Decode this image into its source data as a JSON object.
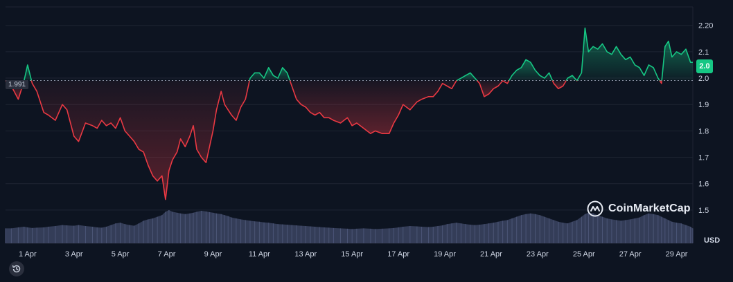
{
  "watermark": {
    "text": "CoinMarketCap"
  },
  "currency": "USD",
  "colors": {
    "up": "#16c784",
    "down": "#ea3943",
    "background": "#0d1421",
    "grid": "#1e2433",
    "volume": "#3c4462"
  },
  "icons": {
    "history": "history-icon",
    "logo": "coinmarketcap-logo-icon"
  },
  "chart_data": {
    "type": "area",
    "reference_value": 1.991,
    "reference_label": "1.991",
    "current_label": "2.0",
    "y_ticks": [
      "2.20",
      "2.1",
      "2.0",
      "1.9",
      "1.8",
      "1.7",
      "1.6",
      "1.5"
    ],
    "y_tick_values": [
      2.2,
      2.1,
      2.0,
      1.9,
      1.8,
      1.7,
      1.6,
      1.5
    ],
    "ylim": [
      1.45,
      2.27
    ],
    "x_ticks": [
      "1 Apr",
      "3 Apr",
      "5 Apr",
      "7 Apr",
      "9 Apr",
      "11 Apr",
      "13 Apr",
      "15 Apr",
      "17 Apr",
      "19 Apr",
      "21 Apr",
      "23 Apr",
      "25 Apr",
      "27 Apr",
      "29 Apr"
    ],
    "x_tick_days": [
      1,
      3,
      5,
      7,
      9,
      11,
      13,
      15,
      17,
      19,
      21,
      23,
      25,
      27,
      29
    ],
    "xlim_days": [
      0.05,
      29.7
    ],
    "series": [
      {
        "x_days": [
          0.05,
          0.3,
          0.6,
          0.85,
          1.0,
          1.2,
          1.4,
          1.7,
          1.9,
          2.2,
          2.5,
          2.7,
          3.0,
          3.2,
          3.5,
          3.8,
          4.0,
          4.2,
          4.4,
          4.6,
          4.8,
          5.0,
          5.2,
          5.4,
          5.6,
          5.8,
          6.0,
          6.2,
          6.4,
          6.6,
          6.8,
          6.95,
          7.1,
          7.25,
          7.45,
          7.6,
          7.8,
          8.0,
          8.15,
          8.3,
          8.5,
          8.7,
          8.85,
          9.0,
          9.15,
          9.35,
          9.5,
          9.65,
          9.8,
          10.0,
          10.2,
          10.4,
          10.6,
          10.8,
          11.0,
          11.2,
          11.4,
          11.6,
          11.8,
          12.0,
          12.2,
          12.4,
          12.6,
          12.8,
          13.0,
          13.2,
          13.4,
          13.6,
          13.8,
          14.0,
          14.2,
          14.5,
          14.8,
          15.0,
          15.2,
          15.5,
          15.8,
          16.0,
          16.3,
          16.6,
          16.8,
          17.0,
          17.2,
          17.5,
          17.8,
          18.0,
          18.3,
          18.5,
          18.7,
          18.9,
          19.1,
          19.3,
          19.5,
          19.7,
          19.9,
          20.1,
          20.3,
          20.5,
          20.7,
          20.9,
          21.1,
          21.3,
          21.5,
          21.7,
          21.9,
          22.1,
          22.3,
          22.5,
          22.7,
          22.9,
          23.1,
          23.3,
          23.5,
          23.7,
          23.9,
          24.1,
          24.3,
          24.5,
          24.7,
          24.9,
          25.05,
          25.2,
          25.4,
          25.6,
          25.8,
          26.0,
          26.2,
          26.4,
          26.6,
          26.8,
          27.0,
          27.2,
          27.4,
          27.6,
          27.8,
          28.0,
          28.2,
          28.35,
          28.5,
          28.65,
          28.8,
          29.0,
          29.2,
          29.4,
          29.6,
          29.7
        ],
        "y": [
          1.99,
          1.97,
          1.92,
          1.99,
          2.05,
          1.98,
          1.95,
          1.87,
          1.86,
          1.84,
          1.9,
          1.88,
          1.78,
          1.76,
          1.83,
          1.82,
          1.81,
          1.84,
          1.82,
          1.83,
          1.81,
          1.85,
          1.8,
          1.78,
          1.76,
          1.73,
          1.72,
          1.67,
          1.63,
          1.61,
          1.63,
          1.54,
          1.65,
          1.69,
          1.72,
          1.77,
          1.74,
          1.78,
          1.82,
          1.73,
          1.7,
          1.68,
          1.74,
          1.8,
          1.88,
          1.95,
          1.9,
          1.88,
          1.86,
          1.84,
          1.89,
          1.92,
          2.0,
          2.02,
          2.02,
          2.0,
          2.04,
          2.01,
          2.0,
          2.04,
          2.02,
          1.97,
          1.92,
          1.9,
          1.89,
          1.87,
          1.86,
          1.87,
          1.85,
          1.85,
          1.84,
          1.83,
          1.85,
          1.82,
          1.83,
          1.81,
          1.79,
          1.8,
          1.79,
          1.79,
          1.83,
          1.86,
          1.9,
          1.88,
          1.91,
          1.92,
          1.93,
          1.93,
          1.95,
          1.98,
          1.97,
          1.96,
          1.99,
          2.0,
          2.01,
          2.02,
          2.0,
          1.98,
          1.93,
          1.94,
          1.96,
          1.97,
          1.99,
          1.98,
          2.01,
          2.03,
          2.04,
          2.07,
          2.06,
          2.03,
          2.01,
          2.0,
          2.02,
          1.98,
          1.96,
          1.97,
          2.0,
          2.01,
          1.99,
          2.02,
          2.19,
          2.1,
          2.12,
          2.11,
          2.13,
          2.1,
          2.09,
          2.12,
          2.09,
          2.07,
          2.08,
          2.05,
          2.04,
          2.01,
          2.05,
          2.04,
          2.0,
          1.98,
          2.12,
          2.14,
          2.08,
          2.1,
          2.09,
          2.11,
          2.06,
          2.06
        ],
        "volume": [
          0.45,
          0.45,
          0.48,
          0.5,
          0.48,
          0.46,
          0.47,
          0.48,
          0.5,
          0.52,
          0.55,
          0.54,
          0.53,
          0.55,
          0.52,
          0.5,
          0.48,
          0.47,
          0.5,
          0.55,
          0.6,
          0.62,
          0.58,
          0.55,
          0.53,
          0.6,
          0.68,
          0.72,
          0.75,
          0.8,
          0.85,
          0.95,
          1.0,
          0.95,
          0.92,
          0.9,
          0.88,
          0.9,
          0.92,
          0.95,
          0.98,
          0.96,
          0.94,
          0.92,
          0.9,
          0.88,
          0.85,
          0.82,
          0.78,
          0.75,
          0.72,
          0.7,
          0.68,
          0.66,
          0.65,
          0.63,
          0.62,
          0.6,
          0.58,
          0.57,
          0.56,
          0.55,
          0.54,
          0.53,
          0.52,
          0.51,
          0.5,
          0.49,
          0.48,
          0.47,
          0.46,
          0.45,
          0.44,
          0.43,
          0.44,
          0.45,
          0.44,
          0.43,
          0.44,
          0.45,
          0.46,
          0.48,
          0.5,
          0.52,
          0.51,
          0.5,
          0.49,
          0.5,
          0.52,
          0.54,
          0.58,
          0.6,
          0.62,
          0.6,
          0.58,
          0.56,
          0.55,
          0.56,
          0.58,
          0.6,
          0.62,
          0.65,
          0.68,
          0.7,
          0.75,
          0.8,
          0.85,
          0.88,
          0.9,
          0.88,
          0.85,
          0.8,
          0.75,
          0.7,
          0.65,
          0.62,
          0.6,
          0.65,
          0.7,
          0.8,
          0.88,
          0.92,
          0.9,
          0.85,
          0.8,
          0.75,
          0.72,
          0.7,
          0.68,
          0.7,
          0.72,
          0.75,
          0.78,
          0.85,
          0.9,
          0.88,
          0.85,
          0.8,
          0.75,
          0.7,
          0.65,
          0.62,
          0.6,
          0.55,
          0.5,
          0.45
        ]
      }
    ],
    "grid": true
  }
}
